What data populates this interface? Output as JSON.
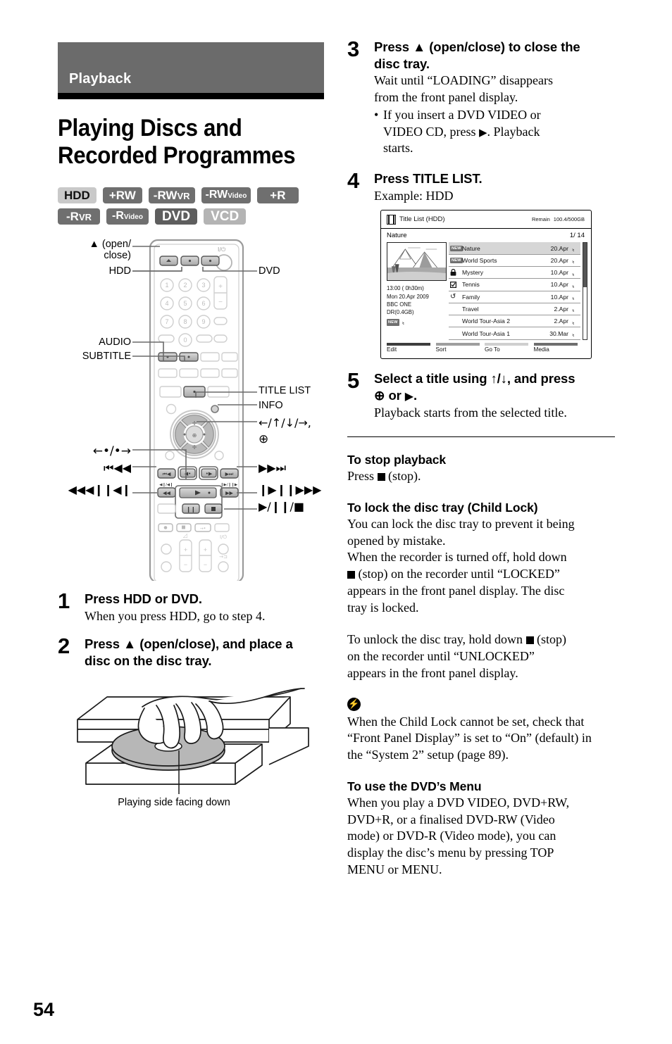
{
  "section": {
    "band_label": "Playback"
  },
  "title": {
    "line1": "Playing Discs and",
    "line2": "Recorded Programmes"
  },
  "disc_badges": {
    "row1": [
      {
        "label": "HDD",
        "bg": "#c9c9c9",
        "fg": "#111111"
      },
      {
        "label": "+RW",
        "bg": "#6f6f6f",
        "fg": "#ffffff"
      },
      {
        "label": "-RW",
        "suffix": "VR",
        "suffix_size": "small-caps",
        "bg": "#6f6f6f",
        "fg": "#ffffff"
      },
      {
        "label": "-RW",
        "suffix": "Video",
        "suffix_size": "sub",
        "bg": "#6f6f6f",
        "fg": "#ffffff"
      },
      {
        "label": "+R",
        "bg": "#6f6f6f",
        "fg": "#ffffff"
      }
    ],
    "row2": [
      {
        "label": "-R",
        "suffix": "VR",
        "suffix_size": "small-caps",
        "bg": "#6f6f6f",
        "fg": "#ffffff"
      },
      {
        "label": "-R",
        "suffix": "Video",
        "suffix_size": "sub",
        "bg": "#6f6f6f",
        "fg": "#ffffff"
      },
      {
        "label": "DVD",
        "bg": "#5e5e5e",
        "fg": "#ffffff"
      },
      {
        "label": "VCD",
        "bg": "#b4b4b4",
        "fg": "#ffffff"
      }
    ]
  },
  "remote_callouts": {
    "open_close_l1": "▲ (open/",
    "open_close_l2": "close)",
    "hdd": "HDD",
    "dvd": "DVD",
    "audio": "AUDIO",
    "subtitle": "SUBTITLE",
    "title_list": "TITLE LIST",
    "info": "INFO",
    "dpad": "←/↑/↓/→,",
    "enter": "⊕",
    "replay_advance": "←•/•→",
    "prev": "⏮◀◀",
    "rew_slow": "◀◀◀❙❙◀❙",
    "next": "▶▶⏭",
    "ff_slow": "❙▶❙❙▶▶▶",
    "play_pause_stop": "▶/❙❙/■"
  },
  "steps_left": [
    {
      "num": "1",
      "title": "Press HDD or DVD.",
      "desc": "When you press HDD, go to step 4."
    },
    {
      "num": "2",
      "title_l1": "Press ▲ (open/close), and place a",
      "title_l2": "disc on the disc tray."
    }
  ],
  "tray_caption": "Playing side facing down",
  "steps_right": [
    {
      "num": "3",
      "title_l1": "Press ▲ (open/close) to close the",
      "title_l2": "disc tray.",
      "desc_l1": "Wait until “LOADING” disappears",
      "desc_l2": "from the front panel display.",
      "bullet_l1": "If you insert a DVD VIDEO or",
      "bullet_l2_a": "VIDEO CD, press ",
      "bullet_l2_b": ". Playback",
      "bullet_l3": "starts."
    },
    {
      "num": "4",
      "title": "Press TITLE LIST.",
      "desc": "Example: HDD"
    },
    {
      "num": "5",
      "title_l1": "Select a title using ↑/↓, and press",
      "title_l2_a": "⊕ or ",
      "title_l2_b": ".",
      "desc": "Playback starts from the selected title."
    }
  ],
  "title_list_screen": {
    "header_title": "Title List (HDD)",
    "remain_label": "Remain",
    "remain_value": "100.4/500GB",
    "current_title": "Nature",
    "position": "1/ 14",
    "meta": {
      "time": "13:00 ( 0h30m)",
      "date": "Mon 20.Apr 2009",
      "channel": "BBC ONE",
      "mode": "DR(0.4GB)",
      "new_tag": "NEW"
    },
    "rows": [
      {
        "icon": "new",
        "name": "Nature",
        "date": "20.Apr",
        "selected": true
      },
      {
        "icon": "new",
        "name": "World Sports",
        "date": "20.Apr",
        "selected": false
      },
      {
        "icon": "lock",
        "name": "Mystery",
        "date": "10.Apr",
        "selected": false
      },
      {
        "icon": "check",
        "name": "Tennis",
        "date": "10.Apr",
        "selected": false
      },
      {
        "icon": "repeat",
        "name": "Family",
        "date": "10.Apr",
        "selected": false
      },
      {
        "icon": "none",
        "name": "Travel",
        "date": "2.Apr",
        "selected": false
      },
      {
        "icon": "none",
        "name": "World Tour-Asia 2",
        "date": "2.Apr",
        "selected": false
      },
      {
        "icon": "none",
        "name": "World Tour-Asia 1",
        "date": "30.Mar",
        "selected": false
      }
    ],
    "footer": [
      {
        "label": "Edit",
        "bar": "#3d3d3d"
      },
      {
        "label": "Sort",
        "bar": "#9e9e9e"
      },
      {
        "label": "Go To",
        "bar": "#cfcfcf"
      },
      {
        "label": "Media",
        "bar": "#6e6e6e"
      }
    ]
  },
  "sections_right": {
    "stop_playback": {
      "heading": "To stop playback",
      "text_a": "Press ",
      "text_b": " (stop)."
    },
    "child_lock": {
      "heading": "To lock the disc tray (Child Lock)",
      "p1_l1": "You can lock the disc tray to prevent it being",
      "p1_l2": "opened by mistake.",
      "p1_l3": "When the recorder is turned off, hold down",
      "p1_l4_b": " (stop) on the recorder until “LOCKED”",
      "p1_l5": "appears in the front panel display. The disc",
      "p1_l6": "tray is locked.",
      "p2_l1_a": "To unlock the disc tray, hold down ",
      "p2_l1_b": " (stop)",
      "p2_l2": "on the recorder until “UNLOCKED”",
      "p2_l3": "appears in the front panel display."
    },
    "note": {
      "icon": "lightning-note-icon",
      "l1": "When the Child Lock cannot be set, check that",
      "l2": "“Front Panel Display” is set to “On” (default) in",
      "l3": "the “System 2” setup (page 89)."
    },
    "dvd_menu": {
      "heading": "To use the DVD’s Menu",
      "l1": "When you play a DVD VIDEO, DVD+RW,",
      "l2": "DVD+R, or a finalised DVD-RW (Video",
      "l3": "mode) or DVD-R (Video mode), you can",
      "l4": "display the disc’s menu by pressing TOP",
      "l5": "MENU or MENU."
    }
  },
  "page_number": "54"
}
